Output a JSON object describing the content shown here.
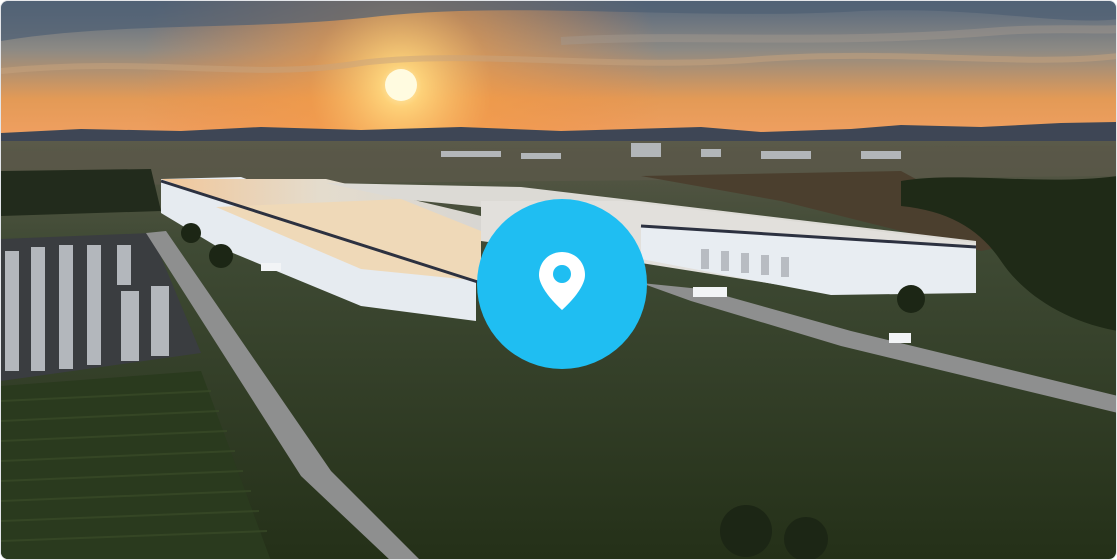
{
  "image": {
    "subject": "aerial-warehouse-sunset",
    "icon": "location-pin-icon",
    "colors": {
      "accent": "#1fbef2",
      "sky_top": "#5c6f86",
      "sky_glow": "#f39a4a",
      "sun": "#fff2b0",
      "grass": "#2e3d22",
      "roof": "#e9ddc8",
      "wall": "#e8edf2"
    }
  }
}
